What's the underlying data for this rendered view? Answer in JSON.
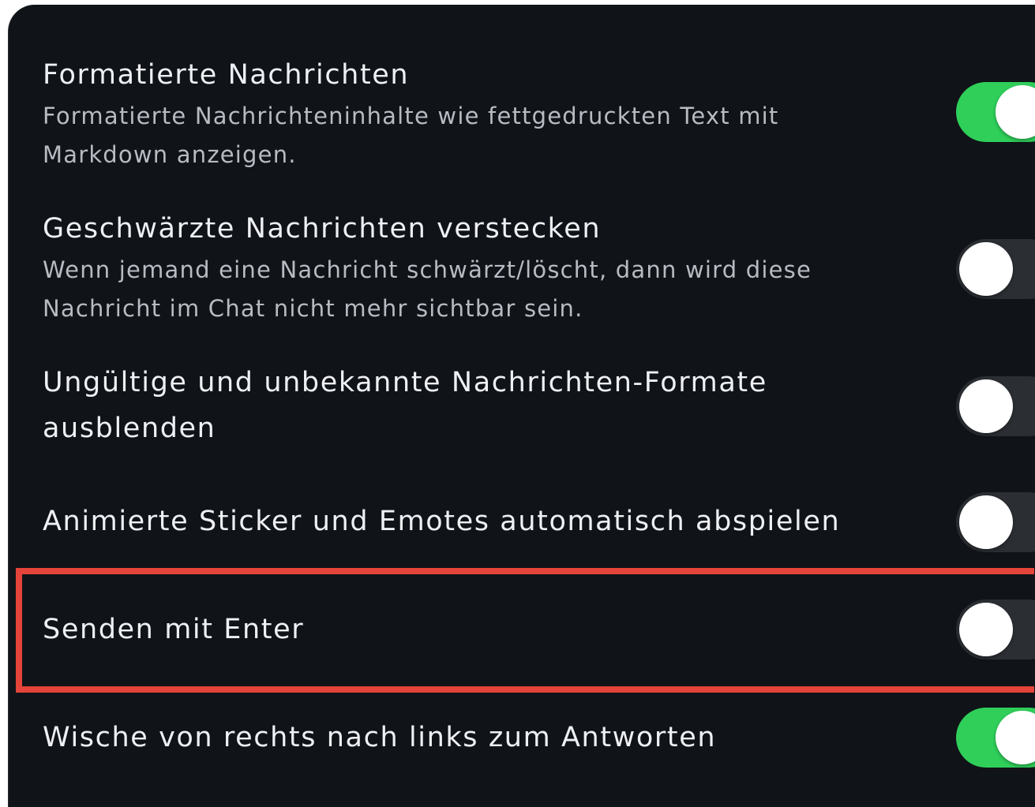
{
  "settings": [
    {
      "title": "Formatierte Nachrichten",
      "description_line1": "Formatierte Nachrichteninhalte wie fettgedruckten Text mit",
      "description_line2": "Markdown anzeigen.",
      "enabled": true
    },
    {
      "title": "Geschwärzte Nachrichten verstecken",
      "description_line1": "Wenn jemand eine Nachricht schwärzt/löscht, dann wird diese",
      "description_line2": "Nachricht im Chat nicht mehr sichtbar sein.",
      "enabled": false
    },
    {
      "title_line1": "Ungültige und unbekannte Nachrichten-Formate",
      "title_line2": "ausblenden",
      "enabled": false
    },
    {
      "title": "Animierte Sticker und Emotes automatisch abspielen",
      "enabled": false
    },
    {
      "title": "Senden mit Enter",
      "enabled": false,
      "highlighted": true
    },
    {
      "title": "Wische von rechts nach links zum Antworten",
      "enabled": true
    }
  ],
  "colors": {
    "background": "#101318",
    "toggle_on": "#2fcf5a",
    "toggle_off": "#2b2e33",
    "highlight": "#e5443a"
  }
}
